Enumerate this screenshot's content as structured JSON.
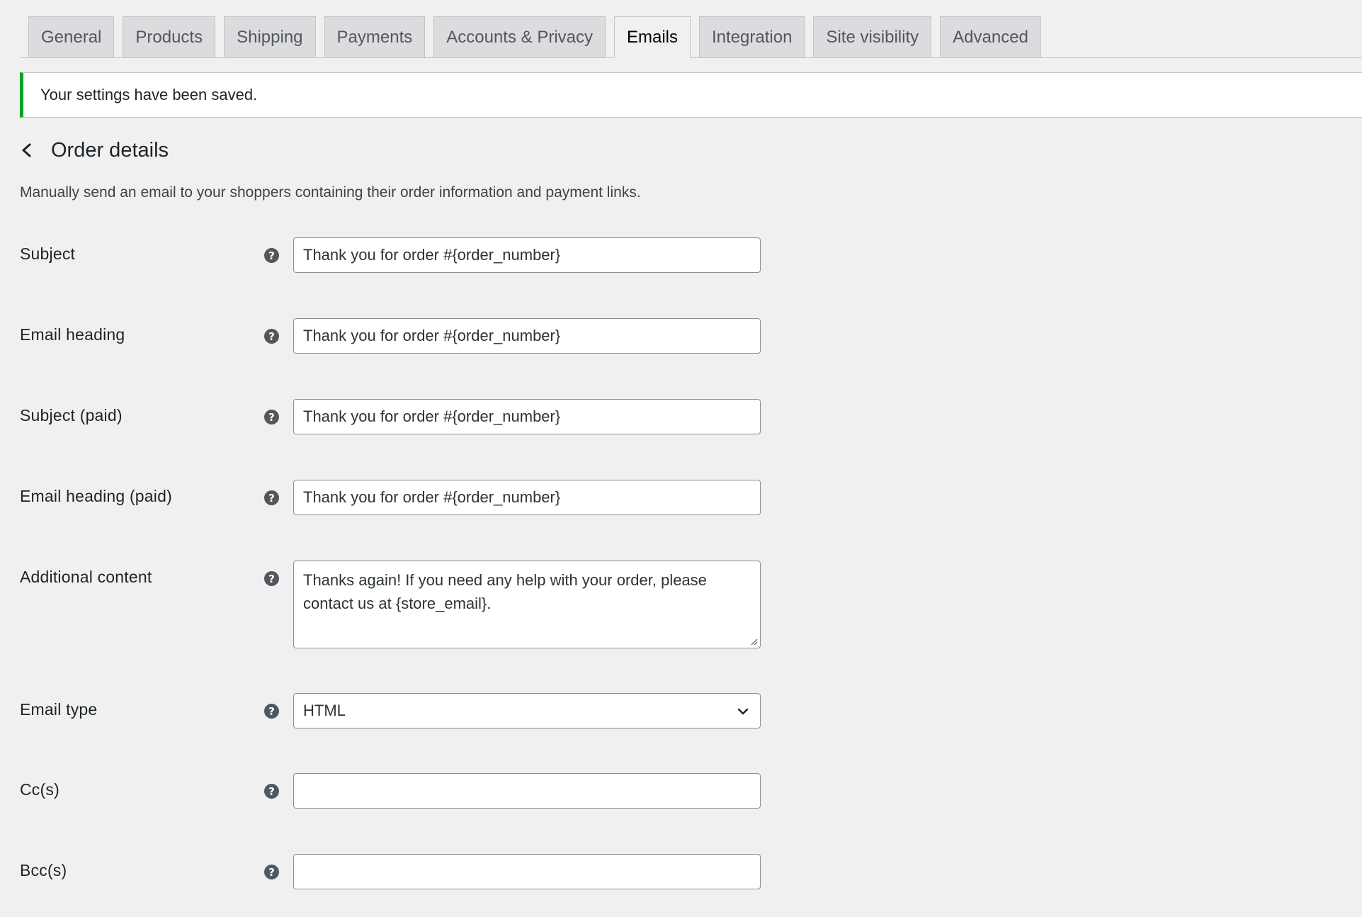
{
  "tabs": [
    {
      "label": "General",
      "active": false
    },
    {
      "label": "Products",
      "active": false
    },
    {
      "label": "Shipping",
      "active": false
    },
    {
      "label": "Payments",
      "active": false
    },
    {
      "label": "Accounts & Privacy",
      "active": false
    },
    {
      "label": "Emails",
      "active": true
    },
    {
      "label": "Integration",
      "active": false
    },
    {
      "label": "Site visibility",
      "active": false
    },
    {
      "label": "Advanced",
      "active": false
    }
  ],
  "notice": {
    "text": "Your settings have been saved.",
    "color": "#00a32a"
  },
  "page": {
    "title": "Order details",
    "description": "Manually send an email to your shoppers containing their order information and payment links."
  },
  "fields": {
    "subject": {
      "label": "Subject",
      "value": "Thank you for order #{order_number}"
    },
    "email_heading": {
      "label": "Email heading",
      "value": "Thank you for order #{order_number}"
    },
    "subject_paid": {
      "label": "Subject (paid)",
      "value": "Thank you for order #{order_number}"
    },
    "email_heading_paid": {
      "label": "Email heading (paid)",
      "value": "Thank you for order #{order_number}"
    },
    "additional_content": {
      "label": "Additional content",
      "value": "Thanks again! If you need any help with your order, please contact us at {store_email}."
    },
    "email_type": {
      "label": "Email type",
      "value": "HTML"
    },
    "cc": {
      "label": "Cc(s)",
      "value": ""
    },
    "bcc": {
      "label": "Bcc(s)",
      "value": ""
    }
  },
  "icons": {
    "help": "?",
    "back": "chevron-left-icon",
    "select": "chevron-down-icon"
  }
}
